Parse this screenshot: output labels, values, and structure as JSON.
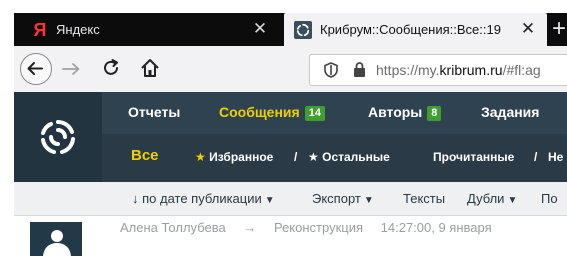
{
  "browser": {
    "tabs": [
      {
        "title": "Яндекс",
        "active": false,
        "icon": "yandex-icon"
      },
      {
        "title": "Крибрум::Сообщения::Все::19",
        "active": true,
        "icon": "kribrum-icon"
      }
    ],
    "tab_close_glyph": "✕",
    "new_tab_glyph": "+",
    "url_scheme": "https://my.",
    "url_domain": "kribrum.ru",
    "url_rest": "/#fl:ag"
  },
  "site": {
    "main_menu": [
      {
        "label": "Отчеты",
        "badge": null,
        "active": false
      },
      {
        "label": "Сообщения",
        "badge": "14",
        "active": true
      },
      {
        "label": "Авторы",
        "badge": "8",
        "active": false
      },
      {
        "label": "Задания",
        "badge": null,
        "active": false
      }
    ],
    "sub_menu": {
      "all": "Все",
      "favorites": "Избранное",
      "slash1": "/",
      "others": "Остальные",
      "read": "Прочитанные",
      "slash2": "/",
      "unread_partial": "Не"
    },
    "filters": {
      "sort": "по дате публикации",
      "sort_arrow": "↓",
      "export": "Экспорт",
      "texts": "Тексты",
      "duplicates": "Дубли",
      "partial": "По"
    },
    "message": {
      "author": "Алена Толлубева",
      "arrow": "→",
      "target": "Реконструкция",
      "time": "14:27:00, 9 января"
    }
  },
  "colors": {
    "header_bg": "#2a3d4a",
    "accent_yellow": "#f0d000",
    "badge_green": "#3f9e2f"
  }
}
